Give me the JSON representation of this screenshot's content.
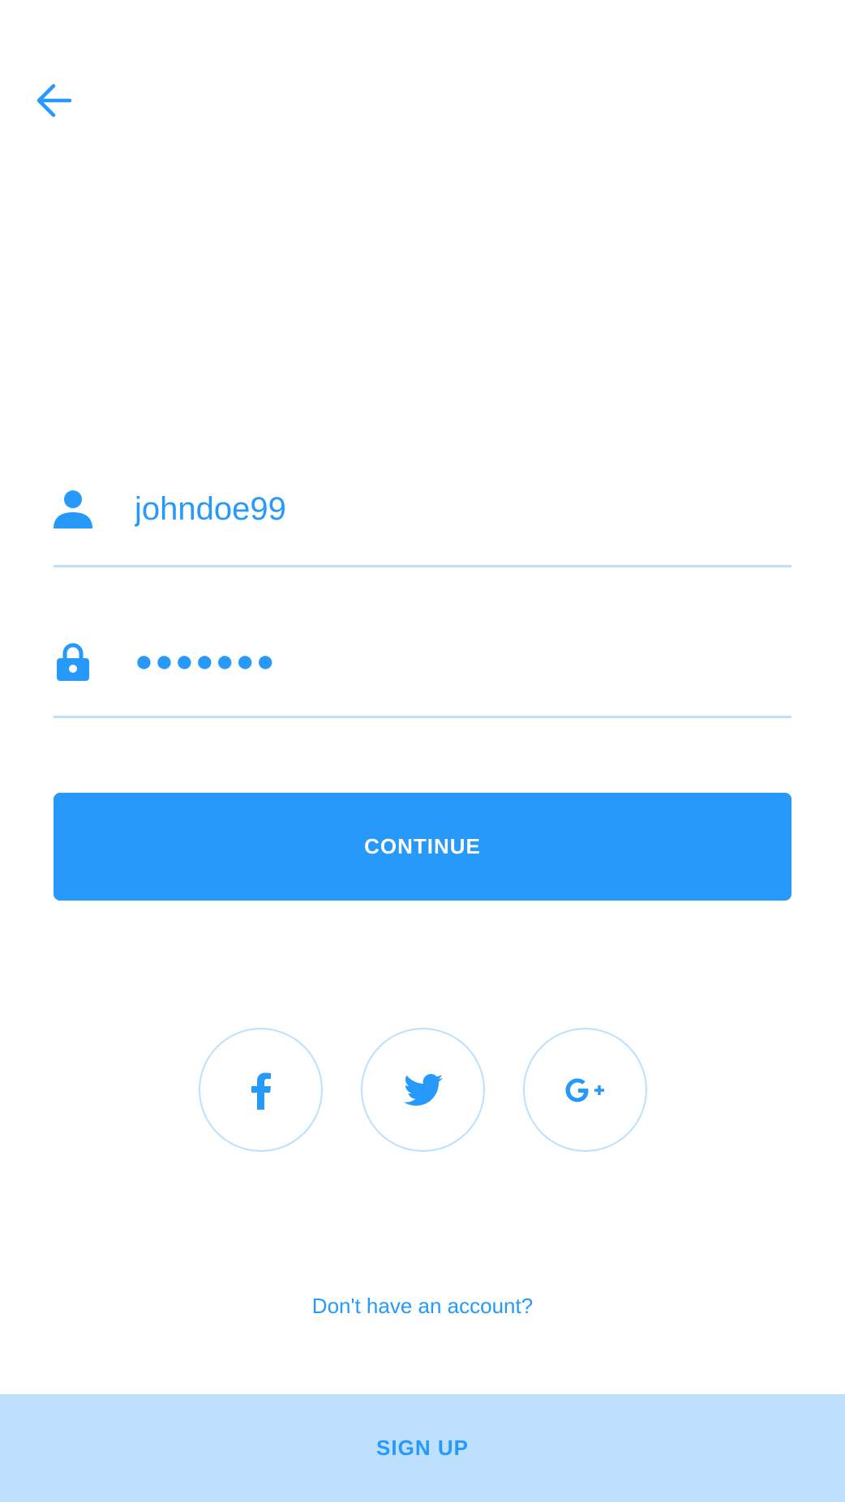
{
  "colors": {
    "accent": "#2699fb",
    "accent_light": "#bce0fd",
    "background": "#ffffff",
    "button_text": "#ffffff"
  },
  "header": {
    "back_icon": "arrow-left-icon"
  },
  "form": {
    "username": {
      "icon": "user-icon",
      "value": "johndoe99"
    },
    "password": {
      "icon": "lock-icon",
      "value": "●●●●●●●"
    },
    "continue_label": "CONTINUE"
  },
  "social": [
    {
      "name": "facebook",
      "icon": "facebook-icon"
    },
    {
      "name": "twitter",
      "icon": "twitter-icon"
    },
    {
      "name": "google-plus",
      "icon": "google-plus-icon"
    }
  ],
  "footer": {
    "prompt": "Don't have an account?",
    "signup_label": "SIGN UP"
  }
}
